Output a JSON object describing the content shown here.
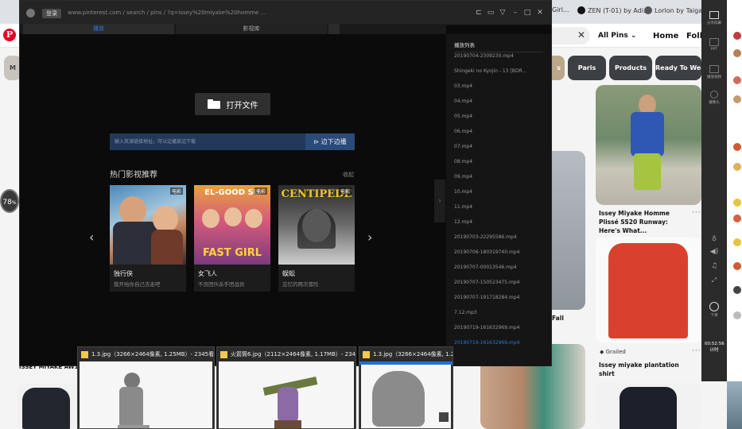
{
  "browser": {
    "tabs": [
      "ZEN (T-01) by Adi...",
      "Lorlon by Taiga ..."
    ],
    "tab_fragment": "Girl..."
  },
  "pinterest": {
    "search_clear_icon": "close-icon",
    "all_pins_label": "All Pins",
    "nav": {
      "home": "Home",
      "following": "Follo"
    },
    "chips": [
      {
        "label": "M",
        "color": "#c8c4bd"
      },
      {
        "label": "s",
        "color": "#bba78a"
      },
      {
        "label": "Paris",
        "color": "#3c3f44"
      },
      {
        "label": "Products",
        "color": "#3c3f44"
      },
      {
        "label": "Ready To Wea",
        "color": "#3c3f44"
      }
    ],
    "pins": [
      {
        "title": "Issey Miyake Homme Plissé SS20 Runway: Here's What...",
        "source": ""
      },
      {
        "title": "Issey miyake plantation shirt",
        "source": "Grailed"
      },
      {
        "title": "Fall",
        "source": ""
      },
      {
        "title": "ISSEY MIYAKE AW1...",
        "source": ""
      }
    ],
    "left_badge": "78",
    "left_badge_unit": "%"
  },
  "player": {
    "login_label": "登录",
    "tabs": {
      "active": "播放",
      "library": "影视库"
    },
    "open_file_label": "打开文件",
    "url_placeholder": "输入资源链接地址，可以边播放边下载",
    "play_download_label": "边下边播",
    "rec_title": "热门影视推荐",
    "rec_more": "收起",
    "cards": [
      {
        "title": "独行侠",
        "desc": "我开始你自己去走吧",
        "tag": "电影"
      },
      {
        "title": "女飞人",
        "desc": "不良团伙杀手团战员",
        "tag": "电影"
      },
      {
        "title": "蜈蚣",
        "desc": "忘忆的两次冒险",
        "tag": "电影"
      }
    ],
    "playlist": {
      "title": "播放列表",
      "items": [
        "20190704-2309230.mp4",
        "Shingeki no Kyojin - 13 [BDR...",
        "03.mp4",
        "04.mp4",
        "05.mp4",
        "06.mp4",
        "07.mp4",
        "08.mp4",
        "09.mp4",
        "10.mp4",
        "11.mp4",
        "12.mp4",
        "20190703-22295586.mp4",
        "20190706-180319740.mp4",
        "20190707-00013546.mp4",
        "20190707-150523475.mp4",
        "20190707-191718284.mp4",
        "7.12.mp3",
        "20190719-161632969.mp4",
        "20190719-161632969.mp4"
      ],
      "selected_index": 19
    }
  },
  "ext_panel": {
    "labels": [
      "分享屏幕",
      "PPT",
      "播放视频",
      "摄像头",
      "下课"
    ],
    "time": "00:52:56",
    "time_caption": "计时"
  },
  "taskbar_previews": [
    {
      "title": "1.3.jpg（3266×2464像素, 1.25MB）- 2345看图..."
    },
    {
      "title": "火箭筒6.jpg（2112×2464像素, 1.17MB）- 2345..."
    },
    {
      "title": "1.3.jpg（3266×2464像素, 1.2..."
    }
  ]
}
